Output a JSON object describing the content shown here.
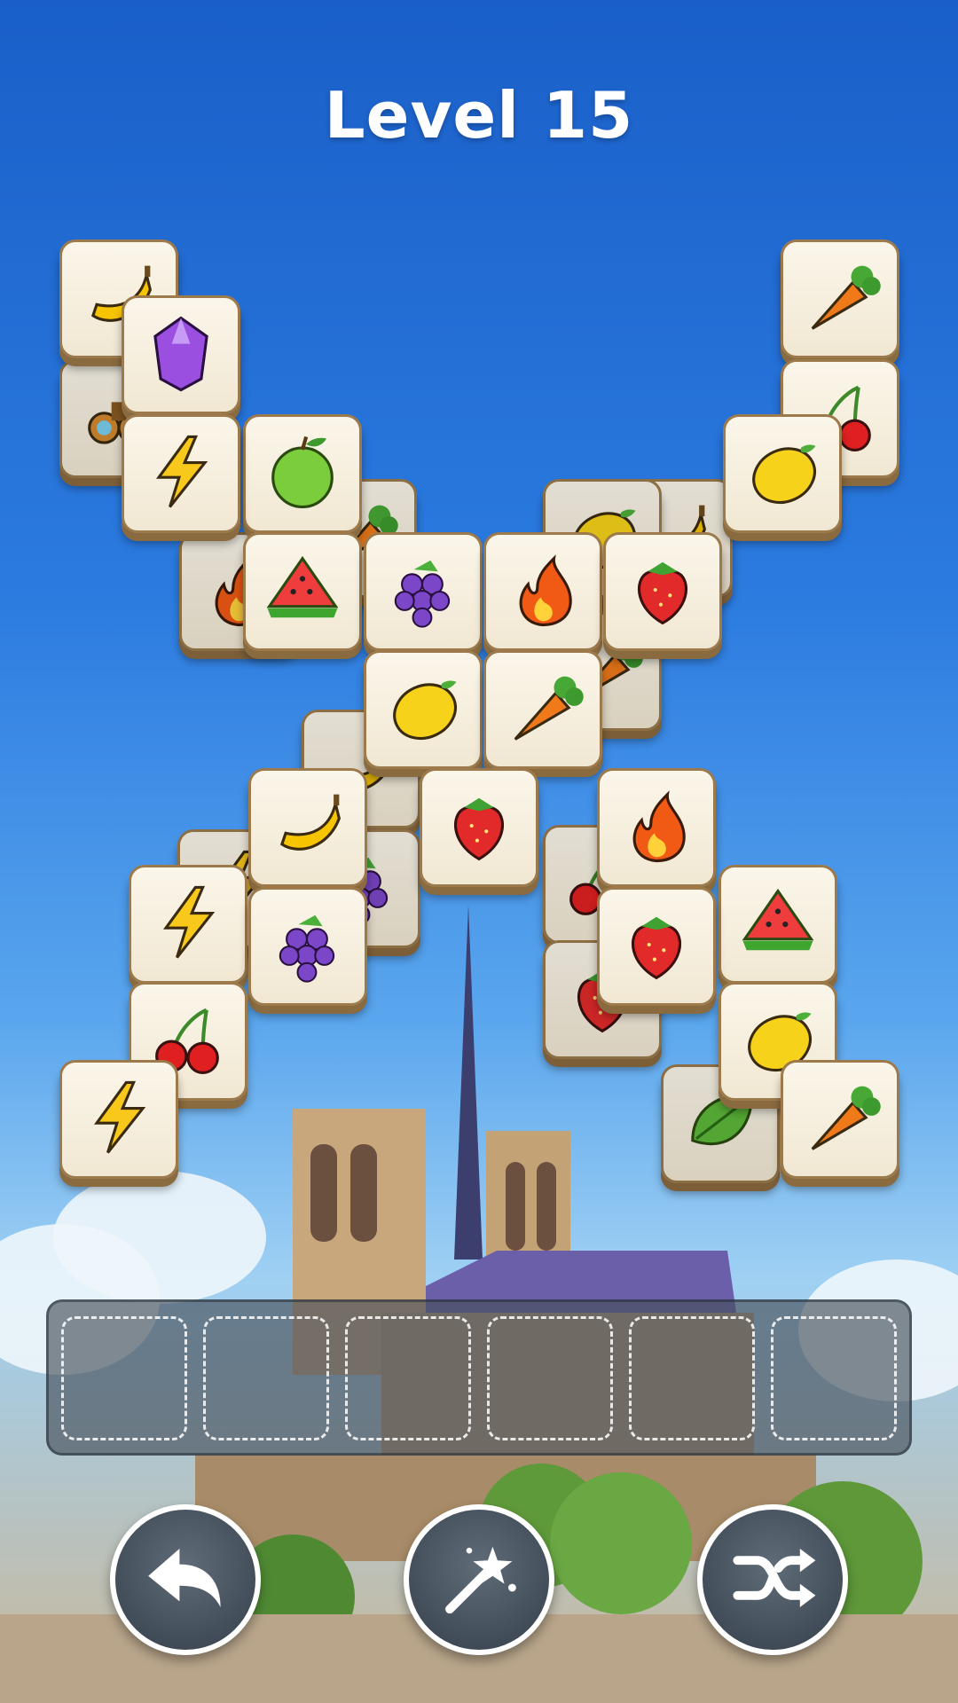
{
  "level": {
    "title": "Level 15"
  },
  "tray": {
    "slot_count": 6
  },
  "buttons": {
    "undo_icon": "undo-arrow-icon",
    "hint_icon": "magic-wand-icon",
    "shuffle_icon": "shuffle-icon"
  },
  "tiles": [
    "banana",
    "lemon",
    "carrot",
    "cherries",
    "strawberry",
    "leaf",
    "binoculars",
    "carrot",
    "banana",
    "fire",
    "grapes",
    "lightning",
    "banana",
    "gem",
    "carrot",
    "cherries",
    "apple",
    "lightning",
    "lemon",
    "watermelon",
    "grapes",
    "fire",
    "strawberry",
    "lemon",
    "carrot",
    "banana",
    "strawberry",
    "fire",
    "lightning",
    "grapes",
    "strawberry",
    "watermelon",
    "cherries",
    "lemon",
    "lightning",
    "carrot"
  ],
  "colors": {
    "tile_face": "#fbf6ea",
    "tile_edge": "#9c7a4c",
    "sky_top": "#1a5fc9",
    "tray": "#46505a"
  }
}
